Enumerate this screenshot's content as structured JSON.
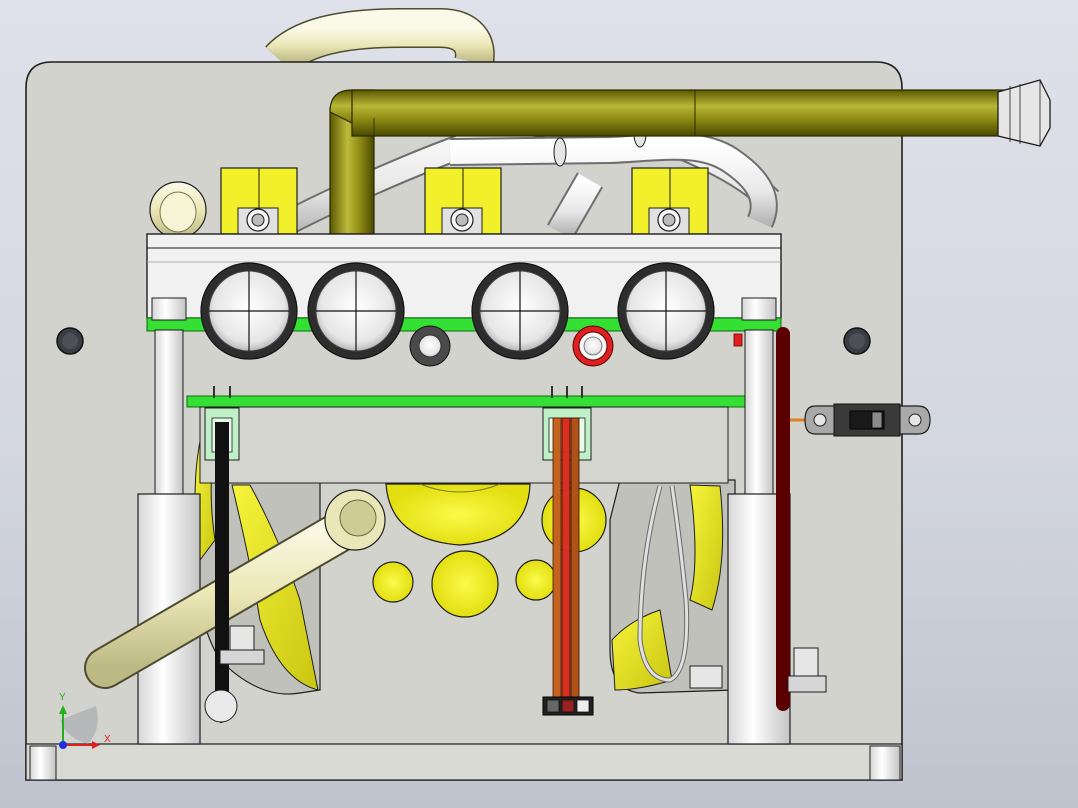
{
  "viewport": {
    "background_top": "#dfe1ea",
    "background_bottom": "#bfc3ce"
  },
  "colors": {
    "plate": "#d2d3cd",
    "olive_pipe": "#8c8a10",
    "cream_pipe": "#ece9c0",
    "white_pipe": "#f3f3f3",
    "yellow": "#f1ef21",
    "green_board": "#33e033",
    "red_wire": "#e01818",
    "brown_wire": "#b55a1a",
    "black_wire": "#2b2b2b",
    "outline": "#1e1e1e"
  },
  "triad": {
    "x_label": "X",
    "y_label": "Y",
    "x_color": "#e02020",
    "y_color": "#20b020",
    "z_color": "#2030e0"
  }
}
